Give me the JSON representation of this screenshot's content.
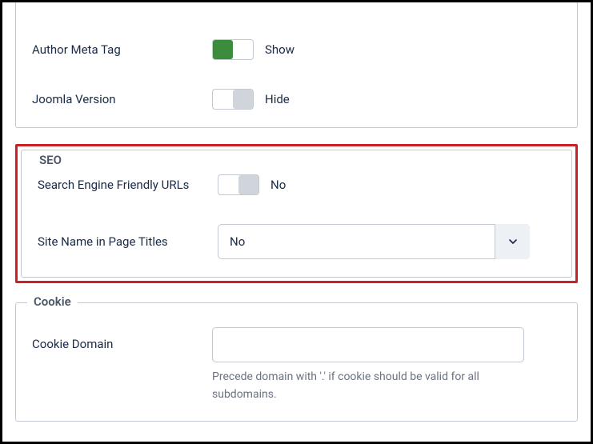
{
  "top_section": {
    "author_meta_tag": {
      "label": "Author Meta Tag",
      "state_text": "Show"
    },
    "joomla_version": {
      "label": "Joomla Version",
      "state_text": "Hide"
    }
  },
  "seo_section": {
    "legend": "SEO",
    "sef_urls": {
      "label": "Search Engine Friendly URLs",
      "state_text": "No"
    },
    "site_name_titles": {
      "label": "Site Name in Page Titles",
      "selected": "No"
    }
  },
  "cookie_section": {
    "legend": "Cookie",
    "cookie_domain": {
      "label": "Cookie Domain",
      "value": "",
      "help": "Precede domain with '.' if cookie should be valid for all subdomains."
    }
  }
}
